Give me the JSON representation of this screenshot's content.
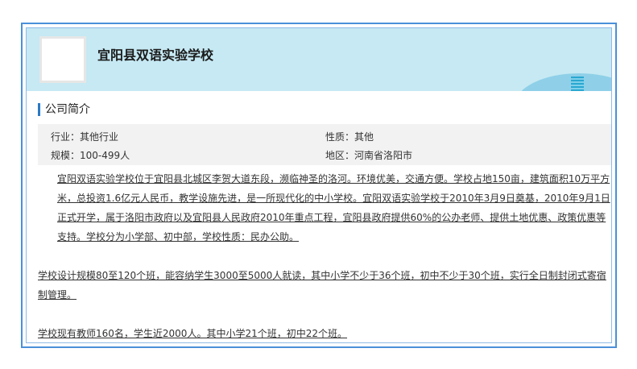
{
  "company": {
    "name": "宜阳县双语实验学校"
  },
  "section": {
    "title": "公司简介"
  },
  "info": {
    "industry": "行业：其他行业",
    "nature": "性质：其他",
    "scale": "规模：100-499人",
    "region": "地区：河南省洛阳市"
  },
  "content": {
    "para1": "宜阳双语实验学校位于宜阳县北城区李贺大道东段，濒临神圣的洛河。环境优美，交通方便。学校占地150亩，建筑面积10万平方米，总投资1.6亿元人民币，教学设施先进，是一所现代化的中小学校。宜阳双语实验学校于2010年3月9日奠基，2010年9月1日正式开学，属于洛阳市政府以及宜阳县人民政府2010年重点工程，宜阳县政府提供60%的公办老师、提供土地优惠、政策优惠等支持。学校分为小学部、初中部，学校性质：民办公助。",
    "para2": "学校设计规模80至120个班，能容纳学生3000至5000人就读，其中小学不少于36个班，初中不少于30个班，实行全日制封闭式寄宿制管理。",
    "para3": "学校现有教师160名，学生近2000人。其中小学21个班，初中22个班。"
  }
}
